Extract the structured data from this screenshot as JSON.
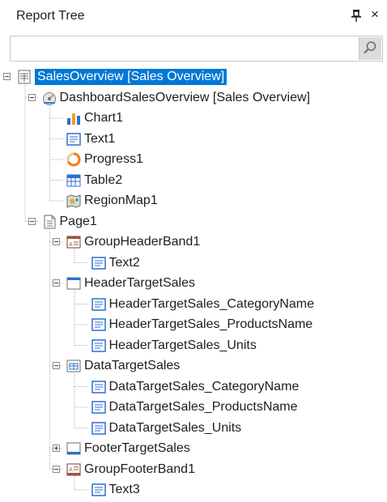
{
  "panel": {
    "title": "Report Tree",
    "pin_icon": "pin-icon",
    "close_glyph": "×",
    "search": {
      "value": "",
      "placeholder": "",
      "icon": "search-icon"
    }
  },
  "tree": {
    "nodes": [
      {
        "label": "SalesOverview [Sales Overview]",
        "icon": "report-icon",
        "expander": "collapse",
        "selected": true
      },
      {
        "label": "DashboardSalesOverview [Sales Overview]",
        "icon": "dashboard-icon",
        "expander": "collapse"
      },
      {
        "label": "Chart1",
        "icon": "chart-icon"
      },
      {
        "label": "Text1",
        "icon": "text-icon"
      },
      {
        "label": "Progress1",
        "icon": "progress-icon"
      },
      {
        "label": "Table2",
        "icon": "table-icon"
      },
      {
        "label": "RegionMap1",
        "icon": "map-icon"
      },
      {
        "label": "Page1",
        "icon": "page-icon",
        "expander": "collapse"
      },
      {
        "label": "GroupHeaderBand1",
        "icon": "group-header-band-icon",
        "expander": "collapse"
      },
      {
        "label": "Text2",
        "icon": "text-icon"
      },
      {
        "label": "HeaderTargetSales",
        "icon": "header-band-icon",
        "expander": "collapse"
      },
      {
        "label": "HeaderTargetSales_CategoryName",
        "icon": "text-icon"
      },
      {
        "label": "HeaderTargetSales_ProductsName",
        "icon": "text-icon"
      },
      {
        "label": "HeaderTargetSales_Units",
        "icon": "text-icon"
      },
      {
        "label": "DataTargetSales",
        "icon": "data-band-icon",
        "expander": "collapse"
      },
      {
        "label": "DataTargetSales_CategoryName",
        "icon": "text-icon"
      },
      {
        "label": "DataTargetSales_ProductsName",
        "icon": "text-icon"
      },
      {
        "label": "DataTargetSales_Units",
        "icon": "text-icon"
      },
      {
        "label": "FooterTargetSales",
        "icon": "footer-band-icon",
        "expander": "expand"
      },
      {
        "label": "GroupFooterBand1",
        "icon": "group-footer-band-icon",
        "expander": "collapse"
      },
      {
        "label": "Text3",
        "icon": "text-icon"
      }
    ]
  },
  "colors": {
    "selection": "#0078d7",
    "tree_line": "#a0a0a0",
    "text": "#1e1e1e"
  }
}
